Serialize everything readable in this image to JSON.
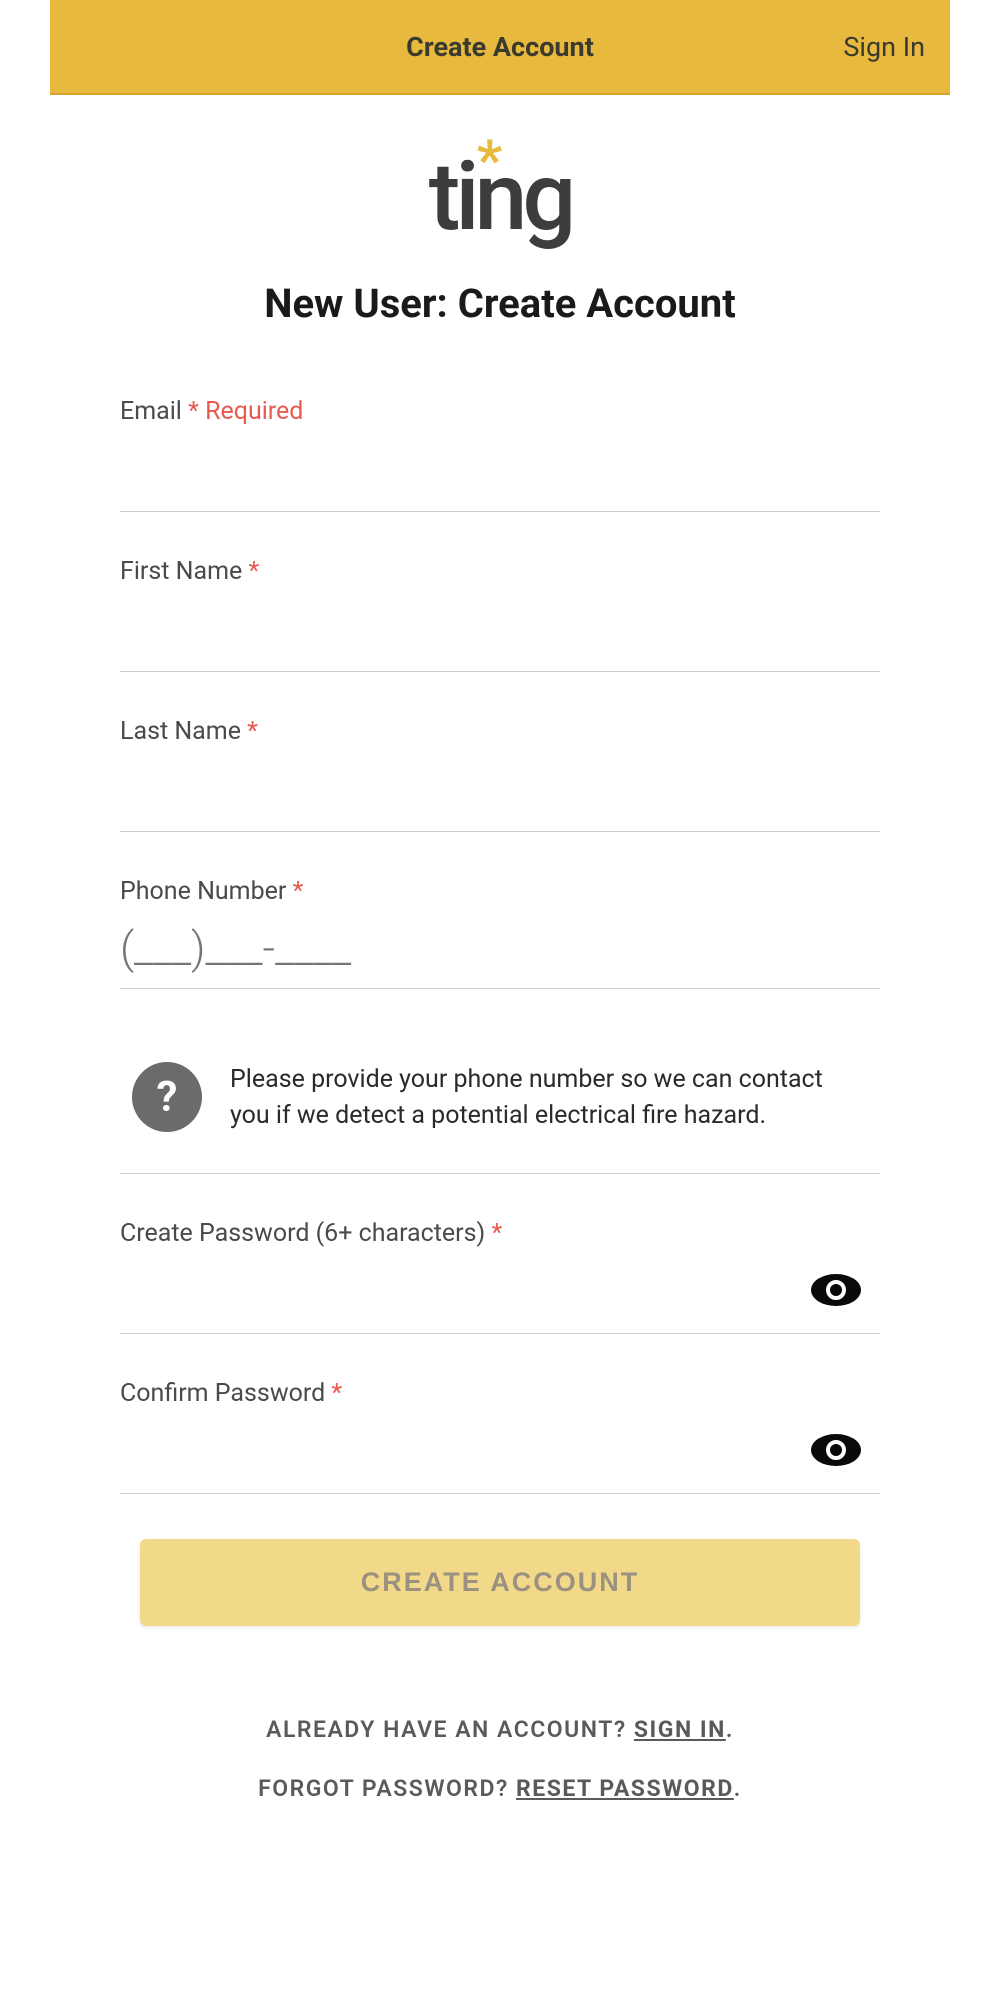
{
  "header": {
    "tabs": {
      "create": "Create Account",
      "signin": "Sign In"
    }
  },
  "logo": {
    "text": "ting"
  },
  "page_title": "New User: Create Account",
  "form": {
    "email": {
      "label": "Email",
      "required_text": "Required"
    },
    "first_name": {
      "label": "First Name"
    },
    "last_name": {
      "label": "Last Name"
    },
    "phone": {
      "label": "Phone Number",
      "placeholder": "(___)___-____"
    },
    "phone_info": "Please provide your phone number so we can contact you if we detect a potential electrical fire hazard.",
    "password": {
      "label": "Create Password (6+ characters)"
    },
    "confirm_password": {
      "label": "Confirm Password"
    },
    "submit_button": "CREATE ACCOUNT"
  },
  "footer": {
    "already_have": "ALREADY HAVE AN ACCOUNT? ",
    "signin_link": "SIGN IN",
    "forgot": "FORGOT PASSWORD? ",
    "reset_link": "RESET PASSWORD"
  },
  "symbols": {
    "star": "*",
    "period": "."
  }
}
